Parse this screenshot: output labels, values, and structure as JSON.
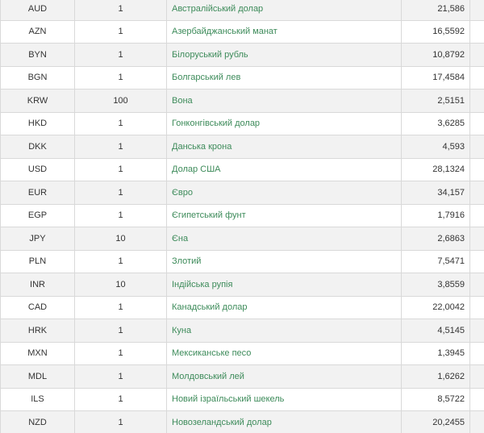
{
  "table": {
    "rows": [
      {
        "code": "AUD",
        "units": "1",
        "name": "Австралійський долар",
        "rate": "21,586"
      },
      {
        "code": "AZN",
        "units": "1",
        "name": "Азербайджанський манат",
        "rate": "16,5592"
      },
      {
        "code": "BYN",
        "units": "1",
        "name": "Білоруський рубль",
        "rate": "10,8792"
      },
      {
        "code": "BGN",
        "units": "1",
        "name": "Болгарський лев",
        "rate": "17,4584"
      },
      {
        "code": "KRW",
        "units": "100",
        "name": "Вона",
        "rate": "2,5151"
      },
      {
        "code": "HKD",
        "units": "1",
        "name": "Гонконгівський долар",
        "rate": "3,6285"
      },
      {
        "code": "DKK",
        "units": "1",
        "name": "Данська крона",
        "rate": "4,593"
      },
      {
        "code": "USD",
        "units": "1",
        "name": "Долар США",
        "rate": "28,1324"
      },
      {
        "code": "EUR",
        "units": "1",
        "name": "Євро",
        "rate": "34,157"
      },
      {
        "code": "EGP",
        "units": "1",
        "name": "Єгипетський фунт",
        "rate": "1,7916"
      },
      {
        "code": "JPY",
        "units": "10",
        "name": "Єна",
        "rate": "2,6863"
      },
      {
        "code": "PLN",
        "units": "1",
        "name": "Злотий",
        "rate": "7,5471"
      },
      {
        "code": "INR",
        "units": "10",
        "name": "Індійська рупія",
        "rate": "3,8559"
      },
      {
        "code": "CAD",
        "units": "1",
        "name": "Канадський долар",
        "rate": "22,0042"
      },
      {
        "code": "HRK",
        "units": "1",
        "name": "Куна",
        "rate": "4,5145"
      },
      {
        "code": "MXN",
        "units": "1",
        "name": "Мексиканське песо",
        "rate": "1,3945"
      },
      {
        "code": "MDL",
        "units": "1",
        "name": "Молдовський лей",
        "rate": "1,6262"
      },
      {
        "code": "ILS",
        "units": "1",
        "name": "Новий ізраїльський шекель",
        "rate": "8,5722"
      },
      {
        "code": "NZD",
        "units": "1",
        "name": "Новозеландський долар",
        "rate": "20,2455"
      }
    ]
  },
  "colors": {
    "name_link": "#3d8b5a",
    "row_alt": "#f2f2f2",
    "border": "#d9d9d9"
  }
}
